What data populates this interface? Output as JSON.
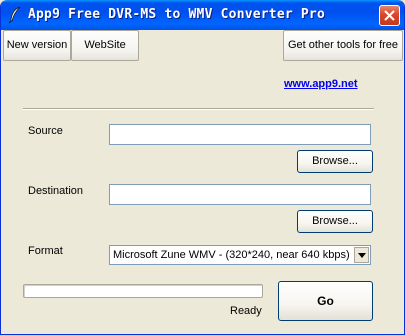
{
  "window": {
    "title": "App9 Free DVR-MS to WMV Converter Pro",
    "app_icon": "feather-icon",
    "close_icon": "close-icon"
  },
  "toolbar": {
    "new_version_label": "New version",
    "website_label": "WebSite",
    "other_tools_label": "Get other tools for free"
  },
  "link": {
    "text": "www.app9.net"
  },
  "source": {
    "label": "Source",
    "value": "",
    "browse_label": "Browse..."
  },
  "destination": {
    "label": "Destination",
    "value": "",
    "browse_label": "Browse..."
  },
  "format": {
    "label": "Format",
    "selected": "Microsoft Zune WMV - (320*240, near 640 kbps)",
    "arrow_icon": "chevron-down-icon"
  },
  "status": {
    "progress_fraction": 0,
    "text": "Ready"
  },
  "actions": {
    "go_label": "Go"
  },
  "colors": {
    "titlebar_blue": "#0053EE",
    "close_red": "#D9472A",
    "link_blue": "#0000EE",
    "window_bg": "#ECE9D8"
  }
}
